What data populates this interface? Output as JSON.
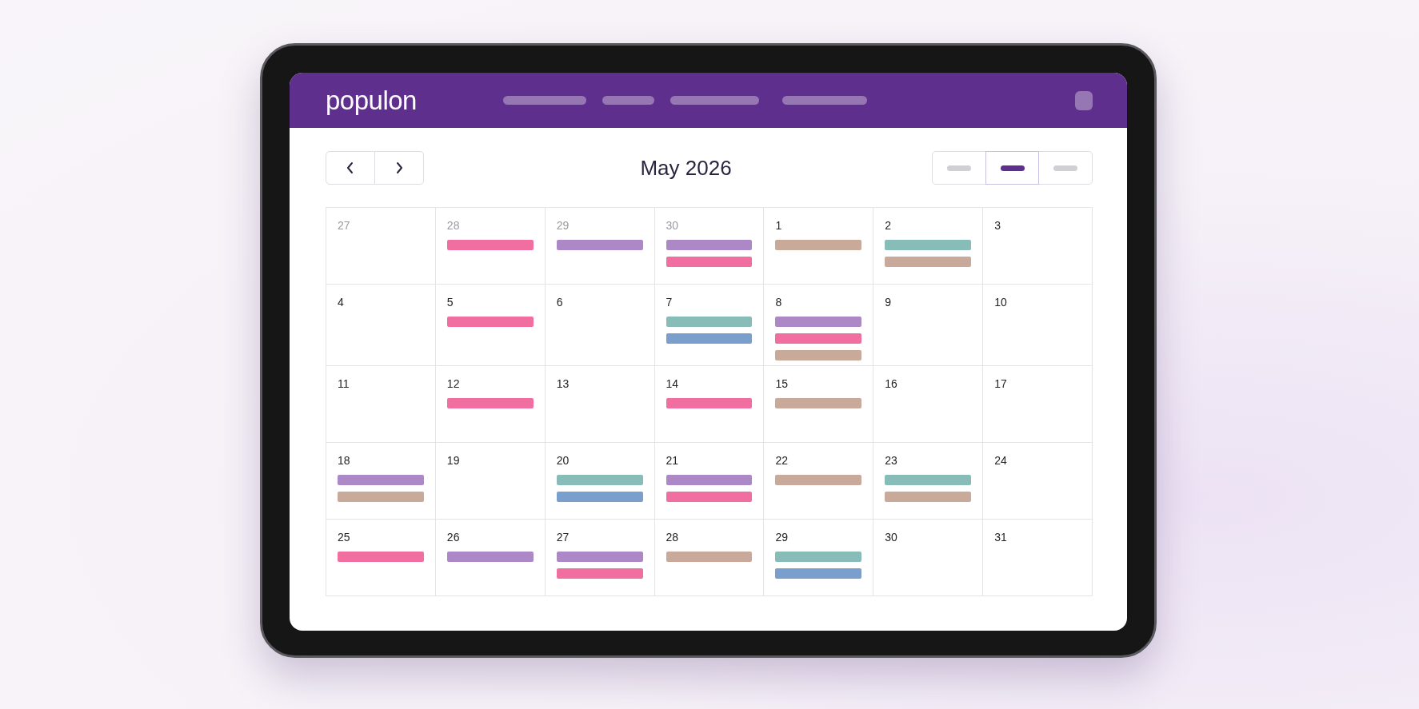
{
  "header": {
    "logo": "populon"
  },
  "toolbar": {
    "month_title": "May 2026",
    "views": [
      {
        "selected": false
      },
      {
        "selected": true
      },
      {
        "selected": false
      }
    ]
  },
  "calendar": {
    "weeks": [
      {
        "days": [
          {
            "day": "27",
            "muted": true
          },
          {
            "day": "28",
            "muted": true,
            "events": [
              {
                "color": "#f06fa0"
              }
            ]
          },
          {
            "day": "29",
            "muted": true,
            "events": [
              {
                "color": "#ad88c6"
              }
            ]
          },
          {
            "day": "30",
            "muted": true,
            "events": [
              {
                "color": "#ad88c6"
              },
              {
                "color": "#f06fa0"
              }
            ]
          },
          {
            "day": "1",
            "muted": false,
            "events": [
              {
                "color": "#c9a99a"
              }
            ]
          },
          {
            "day": "2",
            "muted": false,
            "events": [
              {
                "color": "#88bcb8"
              },
              {
                "color": "#c9a99a"
              }
            ]
          },
          {
            "day": "3",
            "muted": false
          }
        ]
      },
      {
        "days": [
          {
            "day": "4",
            "muted": false
          },
          {
            "day": "5",
            "muted": false,
            "events": [
              {
                "color": "#f06fa0"
              }
            ]
          },
          {
            "day": "6",
            "muted": false
          },
          {
            "day": "7",
            "muted": false,
            "events": [
              {
                "color": "#88bcb8"
              },
              {
                "color": "#7a9fcc"
              }
            ]
          },
          {
            "day": "8",
            "muted": false,
            "events": [
              {
                "color": "#ad88c6"
              },
              {
                "color": "#f06fa0"
              },
              {
                "color": "#c9a99a"
              }
            ]
          },
          {
            "day": "9",
            "muted": false
          },
          {
            "day": "10",
            "muted": false
          }
        ]
      },
      {
        "days": [
          {
            "day": "11",
            "muted": false
          },
          {
            "day": "12",
            "muted": false,
            "events": [
              {
                "color": "#f06fa0"
              }
            ]
          },
          {
            "day": "13",
            "muted": false
          },
          {
            "day": "14",
            "muted": false,
            "events": [
              {
                "color": "#f06fa0"
              }
            ]
          },
          {
            "day": "15",
            "muted": false,
            "events": [
              {
                "color": "#c9a99a"
              }
            ]
          },
          {
            "day": "16",
            "muted": false
          },
          {
            "day": "17",
            "muted": false
          }
        ]
      },
      {
        "days": [
          {
            "day": "18",
            "muted": false,
            "events": [
              {
                "color": "#ad88c6"
              },
              {
                "color": "#c9a99a"
              }
            ]
          },
          {
            "day": "19",
            "muted": false
          },
          {
            "day": "20",
            "muted": false,
            "events": [
              {
                "color": "#88bcb8"
              },
              {
                "color": "#7a9fcc"
              }
            ]
          },
          {
            "day": "21",
            "muted": false,
            "events": [
              {
                "color": "#ad88c6"
              },
              {
                "color": "#f06fa0"
              }
            ]
          },
          {
            "day": "22",
            "muted": false,
            "events": [
              {
                "color": "#c9a99a"
              }
            ]
          },
          {
            "day": "23",
            "muted": false,
            "events": [
              {
                "color": "#88bcb8"
              },
              {
                "color": "#c9a99a"
              }
            ]
          },
          {
            "day": "24",
            "muted": false
          }
        ]
      },
      {
        "days": [
          {
            "day": "25",
            "muted": false,
            "events": [
              {
                "color": "#f06fa0"
              }
            ]
          },
          {
            "day": "26",
            "muted": false,
            "events": [
              {
                "color": "#ad88c6"
              }
            ]
          },
          {
            "day": "27",
            "muted": false,
            "events": [
              {
                "color": "#ad88c6"
              },
              {
                "color": "#f06fa0"
              }
            ]
          },
          {
            "day": "28",
            "muted": false,
            "events": [
              {
                "color": "#c9a99a"
              }
            ]
          },
          {
            "day": "29",
            "muted": false,
            "events": [
              {
                "color": "#88bcb8"
              },
              {
                "color": "#7a9fcc"
              }
            ]
          },
          {
            "day": "30",
            "muted": false
          },
          {
            "day": "31",
            "muted": false
          }
        ]
      }
    ]
  }
}
